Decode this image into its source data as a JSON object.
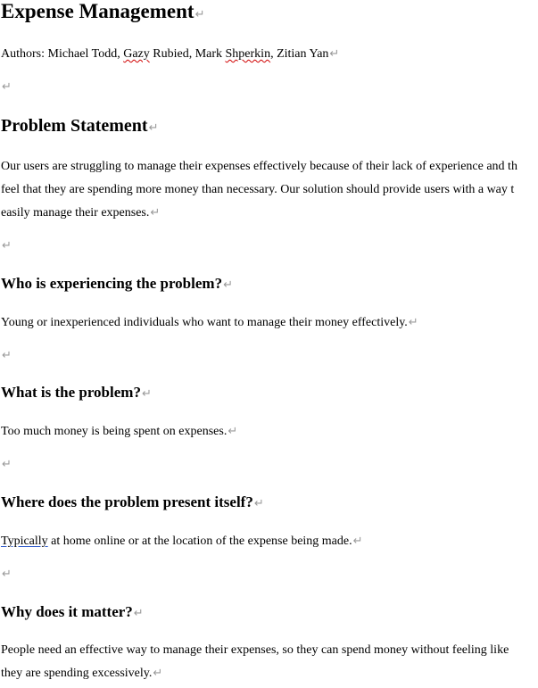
{
  "document": {
    "title": "Expense Management",
    "authors": {
      "prefix": "Authors: Michael Todd, ",
      "name2": "Gazy",
      "name2_rest": " Rubied, Mark ",
      "name3": "Shperkin",
      "name3_rest": ", Zitian Yan"
    },
    "paragraph_mark": "↵",
    "problem_statement": {
      "heading": "Problem Statement",
      "lines": [
        "Our users are struggling to manage their expenses effectively because of their lack of experience and th",
        "feel that they are spending more money than necessary. Our solution should provide users with a way t",
        "easily manage their expenses."
      ]
    },
    "who": {
      "heading": "Who is experiencing the problem?",
      "text": "Young or inexperienced individuals who want to manage their money effectively."
    },
    "what": {
      "heading": "What is the problem?",
      "text": "Too much money is being spent on expenses."
    },
    "where": {
      "heading": "Where does the problem present itself?",
      "text_flagged": "Typically",
      "text_rest": " at home online or at the location of the expense being made."
    },
    "why": {
      "heading": "Why does it matter?",
      "lines": [
        "People need an effective way to manage their expenses, so they can spend money without feeling like",
        "they are spending excessively."
      ]
    }
  }
}
